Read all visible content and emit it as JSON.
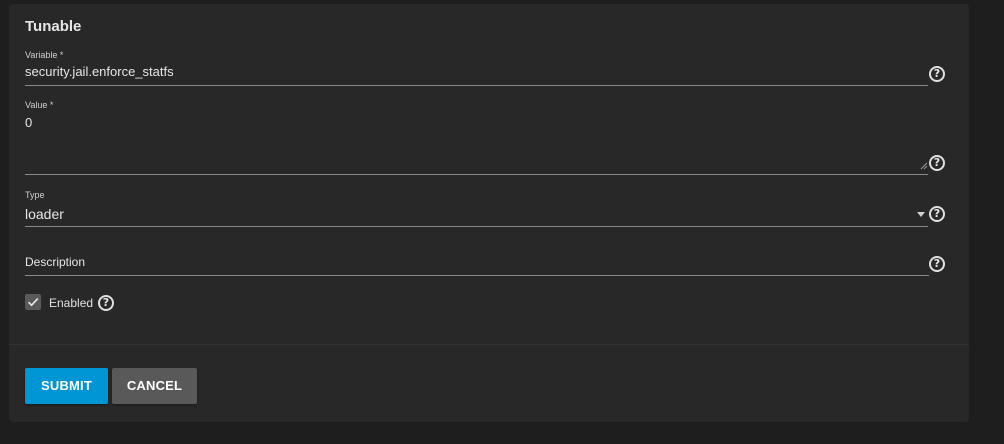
{
  "form": {
    "title": "Tunable",
    "variable": {
      "label": "Variable *",
      "value": "security.jail.enforce_statfs"
    },
    "value": {
      "label": "Value *",
      "value": "0"
    },
    "type": {
      "label": "Type",
      "selected": "loader"
    },
    "description": {
      "placeholder": "Description",
      "value": ""
    },
    "enabled": {
      "label": "Enabled",
      "checked": true
    },
    "help_icon_glyph": "?"
  },
  "actions": {
    "submit_label": "SUBMIT",
    "cancel_label": "CANCEL"
  },
  "colors": {
    "primary": "#0095d5",
    "secondary": "#595959",
    "card_bg": "#282828",
    "page_bg": "#1e1e1e"
  }
}
